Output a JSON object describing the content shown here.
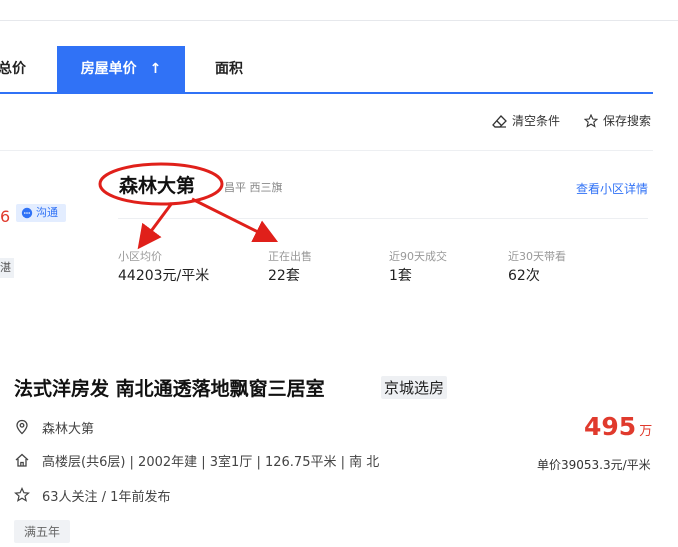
{
  "sort_bar": {
    "total_price": "总价",
    "unit_price": "房屋单价",
    "area": "面积"
  },
  "toolbar": {
    "clear": "清空条件",
    "save_search": "保存搜索"
  },
  "left_fragment": {
    "red_text": "6",
    "chat": "沟通",
    "tag": "湛"
  },
  "community": {
    "name": "森林大第",
    "district": "昌平 西三旗",
    "detail_link": "查看小区详情",
    "stats": [
      {
        "label": "小区均价",
        "value": "44203元/平米"
      },
      {
        "label": "正在出售",
        "value": "22套"
      },
      {
        "label": "近90天成交",
        "value": "1套"
      },
      {
        "label": "近30天带看",
        "value": "62次"
      }
    ]
  },
  "listing": {
    "title": "法式洋房发 南北通透落地飘窗三居室",
    "badge": "京城选房",
    "community": "森林大第",
    "house_info": "高楼层(共6层) | 2002年建 | 3室1厅 | 126.75平米 | 南 北",
    "follow_info": "63人关注 / 1年前发布",
    "total_price": "495",
    "total_unit": "万",
    "unit_price": "单价39053.3元/平米",
    "tag": "满五年"
  },
  "colors": {
    "accent": "#3072f6",
    "price_red": "#e03a2d",
    "annotation_red": "#e0201a"
  }
}
